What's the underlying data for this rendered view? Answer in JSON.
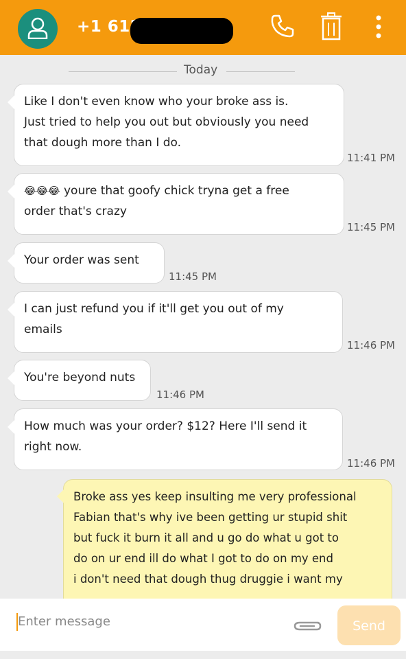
{
  "header": {
    "contact_number": "+1 612–",
    "icons": [
      "person-icon",
      "phone-icon",
      "trash-icon",
      "more-vert-icon"
    ],
    "background": "#f59a0d",
    "avatar_color": "#1b8f7d"
  },
  "thread": {
    "date_divider": "Today",
    "messages": [
      {
        "direction": "incoming",
        "lines": [
          "Like I don't even know who your broke ass is.",
          "Just tried to help you out but obviously you need",
          "that dough more than I do."
        ],
        "time": "11:41 PM"
      },
      {
        "direction": "incoming",
        "emoji": "😂😂😂",
        "lines": [
          "youre that goofy chick tryna get a free",
          "order that's crazy"
        ],
        "time": "11:45 PM"
      },
      {
        "direction": "incoming",
        "lines": [
          "Your order was sent"
        ],
        "time": "11:45 PM"
      },
      {
        "direction": "incoming",
        "lines": [
          "I can just refund you if it'll get you out of my",
          "emails"
        ],
        "time": "11:46 PM"
      },
      {
        "direction": "incoming",
        "lines": [
          "You're beyond nuts"
        ],
        "time": "11:46 PM"
      },
      {
        "direction": "incoming",
        "lines": [
          "How much was your order? $12? Here I'll send it",
          "right now."
        ],
        "time": "11:46 PM"
      },
      {
        "direction": "outgoing",
        "lines": [
          "Broke ass yes keep insulting me very professional",
          "Fabian that's why ive been getting ur stupid shit",
          "but fuck it burn it all and u go do what u got to",
          "do on ur end ill do what I got to do on my end",
          "i don't need that dough thug druggie i want my"
        ]
      }
    ]
  },
  "composer": {
    "placeholder": "Enter message",
    "send_label": "Send",
    "accent": "#f59a0d"
  }
}
